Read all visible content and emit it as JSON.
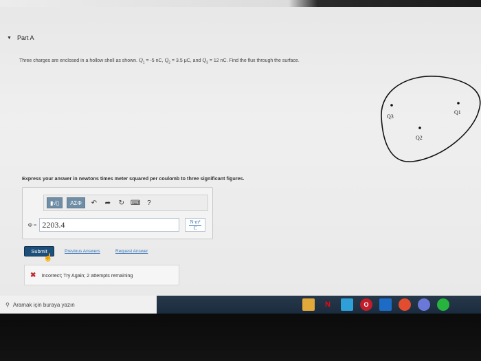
{
  "part": {
    "label": "Part A",
    "chevron_icon": "triangle-down"
  },
  "question": {
    "before_q1": "Three charges are enclosed in a hollow shell as shown. ",
    "q1_symbol": "Q",
    "q1_sub": "1",
    "q1_value": " = -5 nC, ",
    "q2_symbol": "Q",
    "q2_sub": "2",
    "q2_value": " = 3.5 μC, and ",
    "q3_symbol": "Q",
    "q3_sub": "3",
    "q3_value": " = 12 nC. Find the flux through the surface."
  },
  "diagram": {
    "labels": {
      "q1": "Q1",
      "q2": "Q2",
      "q3": "Q3"
    }
  },
  "instructions": "Express your answer in newtons times meter squared per coulomb to three significant figures.",
  "toolbar": {
    "template_label": "▮√▯",
    "greek_label": "ΑΣΦ",
    "undo_icon": "↶",
    "redo_icon": "➦",
    "reset_icon": "↻",
    "keyboard_icon": "⌨",
    "help_label": "?"
  },
  "answer": {
    "symbol": "Φ =",
    "value": "2203.4",
    "units_num": "N·m²",
    "units_den": "C"
  },
  "actions": {
    "submit": "Submit",
    "previous": "Previous Answers",
    "request": "Request Answer"
  },
  "feedback": {
    "icon": "✖",
    "text": "Incorrect; Try Again; 2 attempts remaining"
  },
  "taskbar": {
    "search_placeholder": "Aramak için buraya yazın",
    "search_icon": "⚲"
  },
  "colors": {
    "submit_bg": "#1e4f7a",
    "link": "#3a76b8",
    "error": "#c0272d"
  }
}
